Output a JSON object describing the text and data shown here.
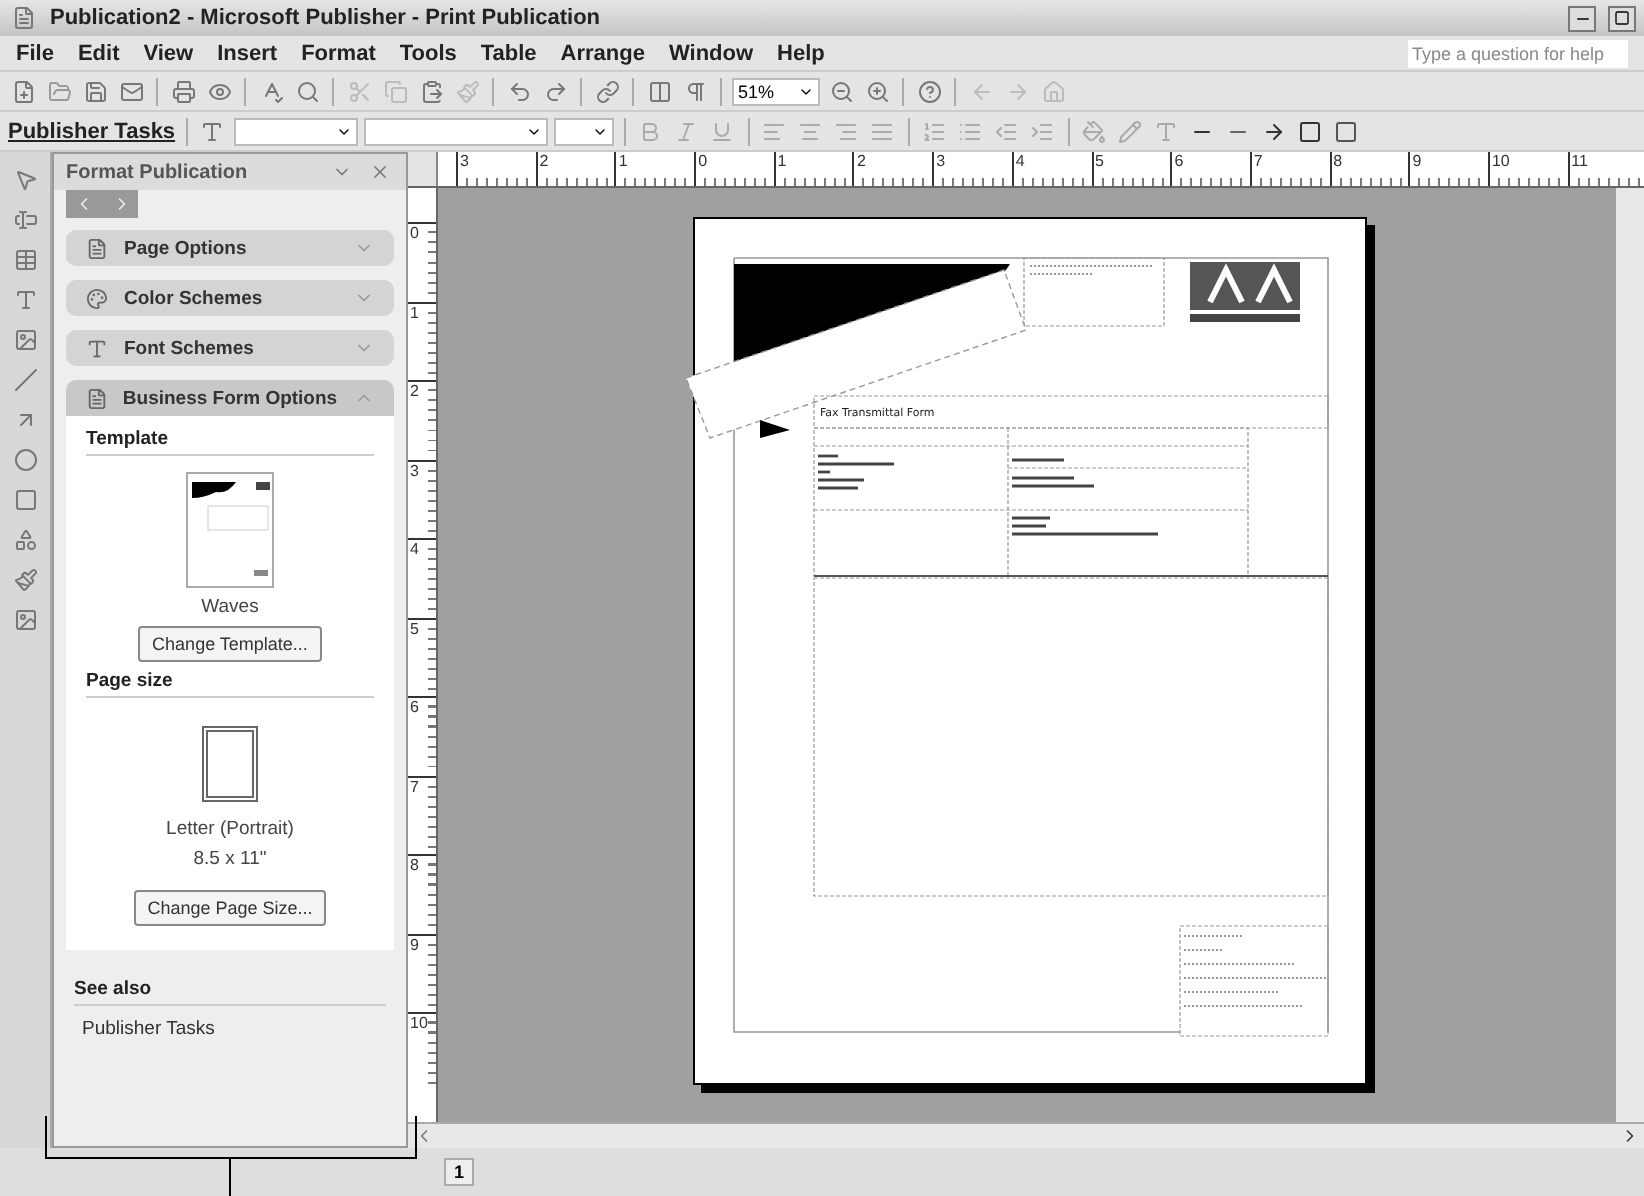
{
  "window": {
    "title": "Publication2 - Microsoft Publisher - Print Publication"
  },
  "menu": [
    "File",
    "Edit",
    "View",
    "Insert",
    "Format",
    "Tools",
    "Table",
    "Arrange",
    "Window",
    "Help"
  ],
  "help_box": {
    "placeholder": "Type a question for help"
  },
  "zoom": {
    "value": "51%"
  },
  "task_toolbar": {
    "label": "Publisher Tasks"
  },
  "task_pane": {
    "title": "Format Publication",
    "sections": [
      {
        "label": "Page Options",
        "expanded": false
      },
      {
        "label": "Color Schemes",
        "expanded": false
      },
      {
        "label": "Font Schemes",
        "expanded": false
      },
      {
        "label": "Business Form Options",
        "expanded": true
      }
    ],
    "template": {
      "heading": "Template",
      "name": "Waves",
      "button": "Change Template..."
    },
    "page_size": {
      "heading": "Page size",
      "name": "Letter (Portrait)",
      "dimensions": "8.5 x 11\"",
      "button": "Change Page Size..."
    },
    "see_also": {
      "heading": "See also",
      "links": [
        "Publisher Tasks"
      ]
    }
  },
  "rulers": {
    "horizontal": [
      "3",
      "2",
      "1",
      "0",
      "1",
      "2",
      "3",
      "4",
      "5",
      "6",
      "7",
      "8",
      "9",
      "10",
      "11"
    ],
    "vertical": [
      "0",
      "1",
      "2",
      "3",
      "4",
      "5",
      "6",
      "7",
      "8",
      "9",
      "10"
    ]
  },
  "document": {
    "form_title": "Fax Transmittal Form"
  },
  "status_bar": {
    "page": "1"
  }
}
